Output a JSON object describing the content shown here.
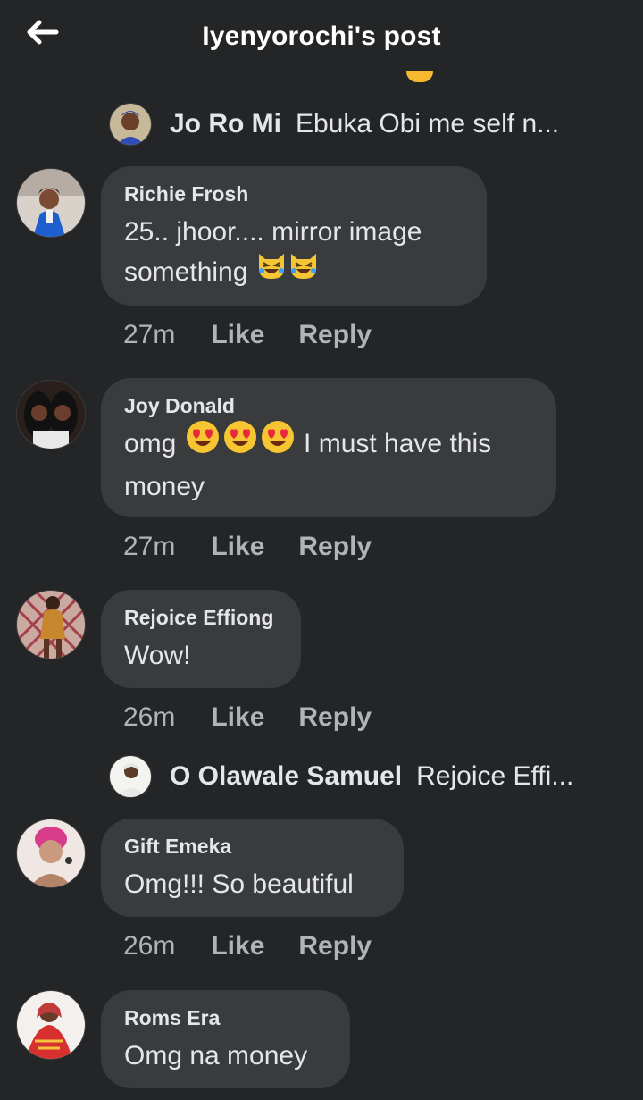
{
  "header": {
    "title": "Iyenyorochi's post"
  },
  "replies": [
    {
      "name": "Jo Ro Mi",
      "preview": "Ebuka Obi me self n..."
    },
    {
      "name": "O Olawale Samuel",
      "preview": "Rejoice Effi..."
    }
  ],
  "comments": [
    {
      "name": "Richie Frosh",
      "line1": "25.. jhoor.... mirror image",
      "line2": "something",
      "emoji": "laughing-cat-face-icon",
      "time": "27m",
      "like": "Like",
      "reply": "Reply"
    },
    {
      "name": "Joy Donald",
      "line1": "omg",
      "line1b": "I must have this",
      "line2": "money",
      "emoji": "heart-eyes-face-icon",
      "time": "27m",
      "like": "Like",
      "reply": "Reply"
    },
    {
      "name": "Rejoice Effiong",
      "line1": "Wow!",
      "time": "26m",
      "like": "Like",
      "reply": "Reply"
    },
    {
      "name": "Gift Emeka",
      "line1": "Omg!!! So beautiful",
      "time": "26m",
      "like": "Like",
      "reply": "Reply"
    },
    {
      "name": "Roms Era",
      "line1": "Omg na money"
    }
  ],
  "colors": {
    "background": "#242526",
    "bubble": "#3a3b3c",
    "meta": "#b0b3b8",
    "text": "#e4e6eb"
  }
}
